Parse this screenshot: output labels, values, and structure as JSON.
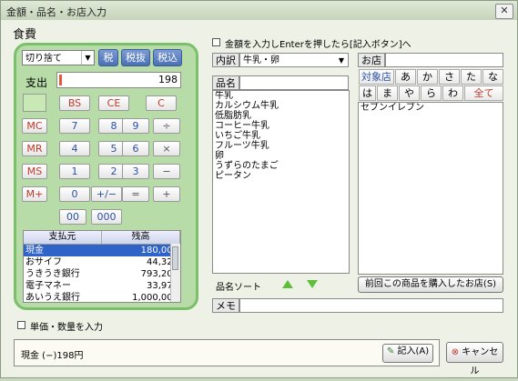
{
  "window": {
    "title": "金額・品名・お店入力",
    "close_glyph": "✕"
  },
  "section_title": "食費",
  "calculator": {
    "rounding": "切り捨て",
    "tax_buttons": [
      "税",
      "税抜",
      "税込"
    ],
    "expense_label": "支出",
    "amount_value": "198",
    "keys": {
      "bs": "BS",
      "ce": "CE",
      "c": "C",
      "mc": "MC",
      "mr": "MR",
      "ms": "MS",
      "mplus": "M+",
      "d7": "7",
      "d8": "8",
      "d9": "9",
      "div": "÷",
      "d4": "4",
      "d5": "5",
      "d6": "6",
      "mul": "×",
      "d1": "1",
      "d2": "2",
      "d3": "3",
      "minus": "−",
      "d0": "0",
      "sign": "+/−",
      "eq": "=",
      "plus": "+",
      "d00": "00",
      "d000": "000"
    },
    "accounts": {
      "header_source": "支払元",
      "header_balance": "残高",
      "rows": [
        {
          "name": "現金",
          "balance": "180,000",
          "selected": true
        },
        {
          "name": "おサイフ",
          "balance": "44,320"
        },
        {
          "name": "うきうき銀行",
          "balance": "793,202"
        },
        {
          "name": "電子マネー",
          "balance": "33,976"
        },
        {
          "name": "あいうえ銀行",
          "balance": "1,000,000"
        }
      ]
    }
  },
  "enter_option_label": "金額を入力しEnterを押したら[記入ボタン]へ",
  "category": {
    "label": "内訳",
    "value": "牛乳・卵"
  },
  "item": {
    "label": "品名",
    "list": [
      "牛乳",
      "カルシウム牛乳",
      "低脂肪乳",
      "コーヒー牛乳",
      "いちご牛乳",
      "フルーツ牛乳",
      "卵",
      "うずらのたまご",
      "ピータン"
    ],
    "sort_label": "品名ソート"
  },
  "shop": {
    "label": "お店",
    "kana_row1": [
      "対象店",
      "あ",
      "か",
      "さ",
      "た",
      "な"
    ],
    "kana_row2": [
      "は",
      "ま",
      "や",
      "ら",
      "わ",
      "全て"
    ],
    "list": [
      "セブンイレブン"
    ],
    "last_shop_button": "前回この商品を購入したお店(S)"
  },
  "memo_label": "メモ",
  "unit_price_option_label": "単価・数量を入力",
  "status": {
    "text": "現金 (−)198円",
    "record_button": "記入(A)"
  },
  "cancel_button": "キャンセル",
  "colors": {
    "panel_green": "#b8dca8",
    "panel_border": "#7ac06a",
    "selection_blue": "#2f63c8",
    "accent_red": "#c0392b",
    "text_blue": "#2a4fa8"
  }
}
